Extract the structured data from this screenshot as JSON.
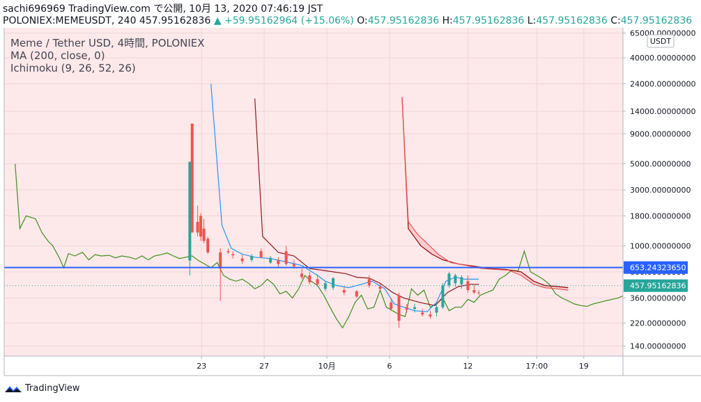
{
  "header": {
    "line1": "sachi696969 TradingView.com で公開, 10月 13, 2020 07:46:19 JST",
    "symbol_info": "POLONIEX:MEMEUSDT, 240 457.95162836",
    "arrow": "▲",
    "change": "+59.95162964 (+15.06%)",
    "o_label": "O:",
    "o_value": "457.95162836",
    "h_label": "H:",
    "h_value": "457.95162836",
    "l_label": "L:",
    "l_value": "457.95162836",
    "c_label": "C:",
    "c_value": "457.95162836"
  },
  "legend": {
    "title": "Meme / Tether USD, 4時間, POLONIEX",
    "ma": "MA (200, close, 0)",
    "ichimoku": "Ichimoku (9, 26, 52, 26)"
  },
  "footer": {
    "brand": "TradingView"
  },
  "colors": {
    "up": "#26a69a",
    "down": "#ef5350",
    "conversion": "#2196f3",
    "base": "#8b1a1a",
    "lagging": "#3f8f1f",
    "lead_a": "#ef5350",
    "lead_b": "#8b0000",
    "cloud": "#f8c8cc",
    "bg": "#fde8ea",
    "ma": "#2962ff",
    "current_price": "#26a69a",
    "ma_price": "#2962ff"
  },
  "chart_data": {
    "type": "candlestick",
    "scale": "log",
    "currency_unit": "USDT",
    "y_ticks": [
      "65000.00000000",
      "40000.00000000",
      "24000.00000000",
      "14000.00000000",
      "9000.00000000",
      "5000.00000000",
      "3000.00000000",
      "1800.00000000",
      "1000.00000000",
      "600.00000000",
      "360.00000000",
      "220.00000000",
      "140.00000000"
    ],
    "y_tick_values": [
      65000,
      40000,
      24000,
      14000,
      9000,
      5000,
      3000,
      1800,
      1000,
      600,
      360,
      220,
      140
    ],
    "y_range": [
      115,
      72000
    ],
    "x_ticks": [
      "23",
      "27",
      "10月",
      "6",
      "12",
      "17:00",
      "19"
    ],
    "x_tick_day_index": [
      2.6,
      6.6,
      10.6,
      14.6,
      19.6,
      24.0,
      27.0
    ],
    "x_range_days": [
      -10,
      29.5
    ],
    "price_labels": [
      {
        "text": "653.24323650",
        "value": 653.24,
        "kind": "ma"
      },
      {
        "text": "457.95162836",
        "value": 457.95,
        "kind": "current"
      }
    ],
    "ma200_value": 653.24,
    "candles": [
      {
        "t": 1.85,
        "o": 750,
        "h": 900,
        "l": 560,
        "c": 5200
      },
      {
        "t": 2.0,
        "o": 11000,
        "h": 11000,
        "l": 1300,
        "c": 1300
      },
      {
        "t": 2.35,
        "o": 1600,
        "h": 2200,
        "l": 1200,
        "c": 1300
      },
      {
        "t": 2.55,
        "o": 1800,
        "h": 1900,
        "l": 1100,
        "c": 1200
      },
      {
        "t": 2.75,
        "o": 1400,
        "h": 1700,
        "l": 1050,
        "c": 1100
      },
      {
        "t": 3.0,
        "o": 1150,
        "h": 1200,
        "l": 850,
        "c": 880
      },
      {
        "t": 3.8,
        "o": 880,
        "h": 950,
        "l": 340,
        "c": 640
      },
      {
        "t": 4.3,
        "o": 900,
        "h": 950,
        "l": 850,
        "c": 880
      },
      {
        "t": 4.6,
        "o": 850,
        "h": 900,
        "l": 780,
        "c": 830
      },
      {
        "t": 5.2,
        "o": 780,
        "h": 840,
        "l": 700,
        "c": 740
      },
      {
        "t": 5.8,
        "o": 760,
        "h": 850,
        "l": 730,
        "c": 820
      },
      {
        "t": 6.4,
        "o": 900,
        "h": 950,
        "l": 780,
        "c": 800
      },
      {
        "t": 7.0,
        "o": 720,
        "h": 820,
        "l": 700,
        "c": 790
      },
      {
        "t": 7.5,
        "o": 760,
        "h": 800,
        "l": 660,
        "c": 700
      },
      {
        "t": 8.0,
        "o": 900,
        "h": 1000,
        "l": 680,
        "c": 700
      },
      {
        "t": 8.5,
        "o": 700,
        "h": 760,
        "l": 640,
        "c": 670
      },
      {
        "t": 9.0,
        "o": 580,
        "h": 640,
        "l": 520,
        "c": 540
      },
      {
        "t": 9.5,
        "o": 560,
        "h": 600,
        "l": 470,
        "c": 490
      },
      {
        "t": 10.0,
        "o": 520,
        "h": 570,
        "l": 450,
        "c": 470
      },
      {
        "t": 10.5,
        "o": 430,
        "h": 500,
        "l": 410,
        "c": 480
      },
      {
        "t": 11.0,
        "o": 440,
        "h": 540,
        "l": 420,
        "c": 530
      },
      {
        "t": 11.7,
        "o": 420,
        "h": 450,
        "l": 380,
        "c": 400
      },
      {
        "t": 12.5,
        "o": 410,
        "h": 420,
        "l": 360,
        "c": 370
      },
      {
        "t": 13.3,
        "o": 520,
        "h": 560,
        "l": 440,
        "c": 460
      },
      {
        "t": 14.0,
        "o": 450,
        "h": 480,
        "l": 420,
        "c": 430
      },
      {
        "t": 14.7,
        "o": 330,
        "h": 360,
        "l": 280,
        "c": 290
      },
      {
        "t": 15.2,
        "o": 380,
        "h": 400,
        "l": 200,
        "c": 230
      },
      {
        "t": 15.7,
        "o": 300,
        "h": 320,
        "l": 270,
        "c": 285
      },
      {
        "t": 16.2,
        "o": 290,
        "h": 320,
        "l": 270,
        "c": 300
      },
      {
        "t": 16.7,
        "o": 270,
        "h": 290,
        "l": 250,
        "c": 260
      },
      {
        "t": 17.2,
        "o": 260,
        "h": 280,
        "l": 240,
        "c": 250
      },
      {
        "t": 17.6,
        "o": 270,
        "h": 320,
        "l": 250,
        "c": 300
      },
      {
        "t": 18.0,
        "o": 300,
        "h": 480,
        "l": 290,
        "c": 460
      },
      {
        "t": 18.4,
        "o": 460,
        "h": 600,
        "l": 440,
        "c": 580
      },
      {
        "t": 18.8,
        "o": 480,
        "h": 580,
        "l": 450,
        "c": 560
      },
      {
        "t": 19.2,
        "o": 470,
        "h": 560,
        "l": 430,
        "c": 540
      },
      {
        "t": 19.6,
        "o": 500,
        "h": 560,
        "l": 400,
        "c": 420
      },
      {
        "t": 20.0,
        "o": 420,
        "h": 460,
        "l": 390,
        "c": 400
      },
      {
        "t": 20.3,
        "o": 400,
        "h": 420,
        "l": 380,
        "c": 398
      }
    ],
    "ichimoku": {
      "conversion": [
        [
          3.2,
          24000
        ],
        [
          3.9,
          1500
        ],
        [
          4.5,
          950
        ],
        [
          5.2,
          850
        ],
        [
          6.0,
          800
        ],
        [
          7.0,
          780
        ],
        [
          8.0,
          730
        ],
        [
          9.0,
          680
        ],
        [
          10.0,
          560
        ],
        [
          10.5,
          500
        ],
        [
          11.2,
          460
        ],
        [
          12.0,
          440
        ],
        [
          12.8,
          470
        ],
        [
          13.5,
          500
        ],
        [
          14.3,
          430
        ],
        [
          14.9,
          320
        ],
        [
          15.5,
          300
        ],
        [
          16.2,
          280
        ],
        [
          17.0,
          275
        ],
        [
          17.6,
          330
        ],
        [
          18.2,
          500
        ],
        [
          18.8,
          540
        ],
        [
          19.4,
          520
        ],
        [
          20.3,
          520
        ]
      ],
      "base": [
        [
          6.0,
          18000
        ],
        [
          6.5,
          1200
        ],
        [
          7.5,
          880
        ],
        [
          8.5,
          820
        ],
        [
          9.5,
          640
        ],
        [
          10.3,
          620
        ],
        [
          11.0,
          600
        ],
        [
          11.8,
          580
        ],
        [
          12.5,
          540
        ],
        [
          13.3,
          530
        ],
        [
          14.0,
          480
        ],
        [
          14.8,
          400
        ],
        [
          15.5,
          360
        ],
        [
          16.5,
          330
        ],
        [
          17.5,
          310
        ],
        [
          18.3,
          400
        ],
        [
          19.0,
          450
        ],
        [
          19.8,
          470
        ],
        [
          20.3,
          470
        ]
      ],
      "lead_a": [
        [
          15.4,
          18500
        ],
        [
          15.8,
          1600
        ],
        [
          16.4,
          1250
        ],
        [
          17.0,
          1050
        ],
        [
          17.7,
          850
        ],
        [
          18.5,
          720
        ],
        [
          19.5,
          680
        ],
        [
          20.5,
          640
        ],
        [
          21.3,
          630
        ],
        [
          22.2,
          620
        ],
        [
          23.0,
          560
        ],
        [
          23.8,
          470
        ],
        [
          24.5,
          440
        ],
        [
          25.3,
          430
        ],
        [
          26.0,
          420
        ]
      ],
      "lead_b": [
        [
          15.4,
          18500
        ],
        [
          15.8,
          1400
        ],
        [
          16.6,
          1000
        ],
        [
          17.3,
          850
        ],
        [
          18.0,
          760
        ],
        [
          19.0,
          700
        ],
        [
          20.0,
          670
        ],
        [
          21.0,
          640
        ],
        [
          22.0,
          630
        ],
        [
          23.0,
          600
        ],
        [
          23.8,
          500
        ],
        [
          24.5,
          460
        ],
        [
          25.3,
          450
        ],
        [
          26.0,
          440
        ]
      ],
      "lagging": [
        [
          -9.3,
          5000
        ],
        [
          -9.0,
          1400
        ],
        [
          -8.6,
          1800
        ],
        [
          -8.0,
          1700
        ],
        [
          -7.6,
          1300
        ],
        [
          -7.2,
          1100
        ],
        [
          -6.9,
          1000
        ],
        [
          -6.5,
          800
        ],
        [
          -6.2,
          650
        ],
        [
          -5.9,
          860
        ],
        [
          -5.5,
          820
        ],
        [
          -5.0,
          880
        ],
        [
          -4.6,
          760
        ],
        [
          -4.2,
          840
        ],
        [
          -3.8,
          820
        ],
        [
          -3.3,
          830
        ],
        [
          -2.9,
          790
        ],
        [
          -2.5,
          820
        ],
        [
          -2.0,
          800
        ],
        [
          -1.6,
          770
        ],
        [
          -1.2,
          820
        ],
        [
          -0.8,
          760
        ],
        [
          -0.4,
          820
        ],
        [
          0.0,
          840
        ],
        [
          0.4,
          870
        ],
        [
          0.8,
          820
        ],
        [
          1.2,
          780
        ],
        [
          1.6,
          800
        ],
        [
          2.0,
          820
        ],
        [
          2.4,
          750
        ],
        [
          2.8,
          700
        ],
        [
          3.2,
          650
        ],
        [
          3.6,
          720
        ],
        [
          4.0,
          560
        ],
        [
          4.4,
          520
        ],
        [
          4.8,
          500
        ],
        [
          5.2,
          520
        ],
        [
          5.6,
          480
        ],
        [
          6.0,
          430
        ],
        [
          6.4,
          460
        ],
        [
          6.8,
          520
        ],
        [
          7.2,
          470
        ],
        [
          7.6,
          390
        ],
        [
          8.0,
          410
        ],
        [
          8.4,
          360
        ],
        [
          8.8,
          430
        ],
        [
          9.2,
          560
        ],
        [
          9.6,
          500
        ],
        [
          10.0,
          460
        ],
        [
          10.4,
          380
        ],
        [
          10.8,
          300
        ],
        [
          11.2,
          240
        ],
        [
          11.6,
          200
        ],
        [
          12.0,
          250
        ],
        [
          12.4,
          330
        ],
        [
          12.8,
          380
        ],
        [
          13.2,
          290
        ],
        [
          13.6,
          300
        ],
        [
          14.0,
          420
        ],
        [
          14.4,
          300
        ],
        [
          14.8,
          280
        ],
        [
          15.2,
          260
        ],
        [
          15.6,
          250
        ],
        [
          16.0,
          430
        ],
        [
          16.4,
          380
        ],
        [
          16.8,
          420
        ],
        [
          17.2,
          300
        ],
        [
          17.6,
          320
        ],
        [
          18.0,
          360
        ],
        [
          18.4,
          280
        ],
        [
          18.8,
          300
        ],
        [
          19.2,
          300
        ],
        [
          19.6,
          350
        ],
        [
          20.0,
          330
        ],
        [
          20.4,
          380
        ],
        [
          20.8,
          400
        ],
        [
          21.2,
          420
        ],
        [
          21.6,
          520
        ],
        [
          22.0,
          560
        ],
        [
          22.4,
          620
        ],
        [
          22.8,
          610
        ],
        [
          23.2,
          900
        ],
        [
          23.6,
          600
        ],
        [
          24.0,
          560
        ],
        [
          24.4,
          520
        ],
        [
          24.8,
          470
        ],
        [
          25.2,
          390
        ],
        [
          25.6,
          360
        ],
        [
          26.0,
          340
        ],
        [
          26.4,
          320
        ],
        [
          26.8,
          310
        ],
        [
          27.2,
          305
        ],
        [
          27.6,
          320
        ],
        [
          28.0,
          330
        ],
        [
          28.4,
          340
        ],
        [
          28.8,
          350
        ],
        [
          29.2,
          360
        ],
        [
          29.6,
          380
        ],
        [
          30.0,
          420
        ],
        [
          30.4,
          480
        ],
        [
          30.8,
          540
        ],
        [
          31.2,
          560
        ],
        [
          31.6,
          600
        ]
      ]
    }
  }
}
